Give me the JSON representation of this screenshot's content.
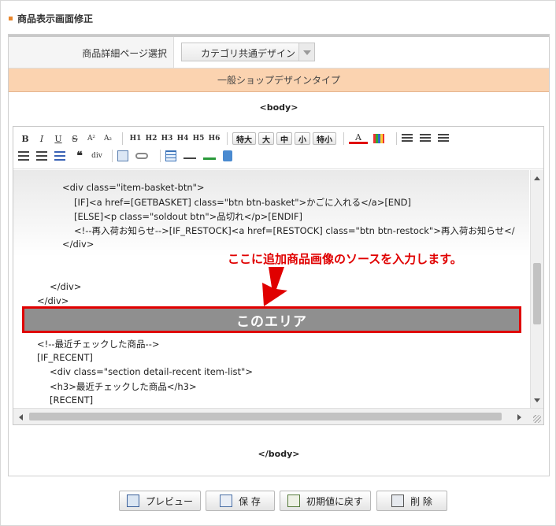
{
  "header": {
    "title": "商品表示画面修正"
  },
  "detail_select": {
    "label": "商品詳細ページ選択",
    "value": "カテゴリ共通デザイン"
  },
  "design_bar": {
    "label": "一般ショップデザインタイプ"
  },
  "tags": {
    "body_open": "<body>",
    "body_close": "</body>"
  },
  "toolbar": {
    "bold": "B",
    "italic": "I",
    "underline": "U",
    "strike": "S",
    "superscript": "A²",
    "subscript": "A₂",
    "headings": [
      "H1",
      "H2",
      "H3",
      "H4",
      "H5",
      "H6"
    ],
    "sizes": [
      "特大",
      "大",
      "中",
      "小",
      "特小"
    ],
    "font_color": "A",
    "quote": "❝",
    "div": "div"
  },
  "code_lines": [
    "<div class=\"item-basket-btn\">",
    "[IF]<a href=[GETBASKET] class=\"btn btn-basket\">かごに入れる</a>[END]",
    "[ELSE]<p class=\"soldout btn\">品切れ</p>[ENDIF]",
    "<!--再入荷お知らせ-->[IF_RESTOCK]<a href=[RESTOCK] class=\"btn btn-restock\">再入荷お知らせ</",
    "</div>",
    "</div>",
    "</div>",
    "<!--最近チェックした商品-->",
    "[IF_RECENT]",
    "<div class=\"section detail-recent item-list\">",
    "<h3>最近チェックした商品</h3>",
    "[RECENT]"
  ],
  "annotation": "ここに追加商品画像のソースを入力します。",
  "highlight_area": "このエリア",
  "actions": {
    "preview": "プレビュー",
    "save": "保 存",
    "reset": "初期値に戻す",
    "delete": "削 除"
  },
  "colors": {
    "accent_orange": "#e9862b",
    "design_bar": "#fbd3b0",
    "annotation_red": "#e00000",
    "highlight_gray": "#8f8f8f"
  }
}
